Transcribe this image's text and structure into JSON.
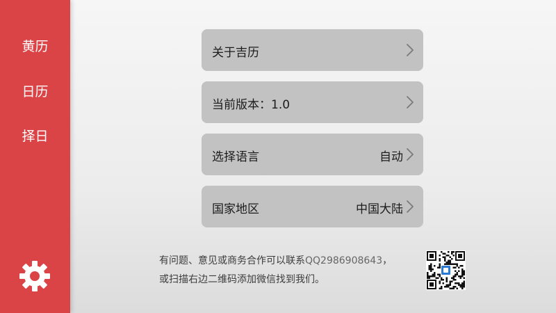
{
  "sidebar": {
    "items": [
      {
        "label": "黄历"
      },
      {
        "label": "日历"
      },
      {
        "label": "择日"
      }
    ],
    "settings_icon": "gear-icon",
    "background": "#db4447"
  },
  "settings": {
    "rows": [
      {
        "label": "关于吉历",
        "value": ""
      },
      {
        "label": "当前版本：1.0",
        "value": ""
      },
      {
        "label": "选择语言",
        "value": "自动"
      },
      {
        "label": "国家地区",
        "value": "中国大陆"
      }
    ],
    "chevron_icon": "chevron-right-icon"
  },
  "footer": {
    "line1_prefix": "有问题、意见或商务合作可以联系",
    "qq": "QQ2986908643",
    "line1_suffix": "，",
    "line2": "或扫描右边二维码添加微信找到我们。",
    "qr_icon": "qr-code-icon"
  }
}
